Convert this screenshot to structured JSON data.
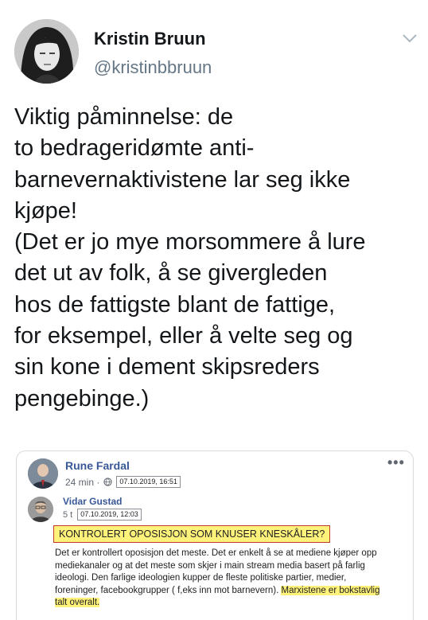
{
  "author": {
    "display_name": "Kristin Bruun",
    "handle": "@kristinbbruun"
  },
  "tweet": {
    "lines": [
      "Viktig påminnelse: de",
      "to bedrageridømte anti-",
      "barnevernaktivistene lar seg ikke",
      "kjøpe!",
      "(Det er jo mye morsommere å lure",
      "det ut av folk, å se givergleden",
      "hos de fattigste blant de fattige,",
      "for eksempel, eller å velte seg og",
      "sin kone i dement skipsreders",
      "pengebinge.)"
    ]
  },
  "embed": {
    "post_author": "Rune Fardal",
    "post_time": "24 min ·",
    "post_date": "07.10.2019, 16:51",
    "more": "•••",
    "comment_author": "Vidar Gustad",
    "comment_time": "5 t",
    "comment_date": "07.10.2019, 12:03",
    "headline": "KONTROLERT OPOSISJON SOM KNUSER KNESKÅLER?",
    "body_lines": [
      "Det er kontrollert oposisjon det meste. Det er enkelt å se at mediene kjøper opp",
      "mediekanaler og at det meste som skjer i main stream media basert på farlig",
      "ideologi. Den farlige ideologien kupper de fleste politiske partier, medier,",
      "foreninger, facebookgrupper ( f,eks inn mot barnevern).",
      "Marxistene er bokstavlig",
      "talt overalt."
    ]
  },
  "icons": {
    "chevron": "chevron-down-icon",
    "globe": "globe-icon"
  },
  "colors": {
    "name_link": "#385898",
    "handle": "#657786",
    "highlight": "#fff27a",
    "border_red": "#c0392b"
  }
}
